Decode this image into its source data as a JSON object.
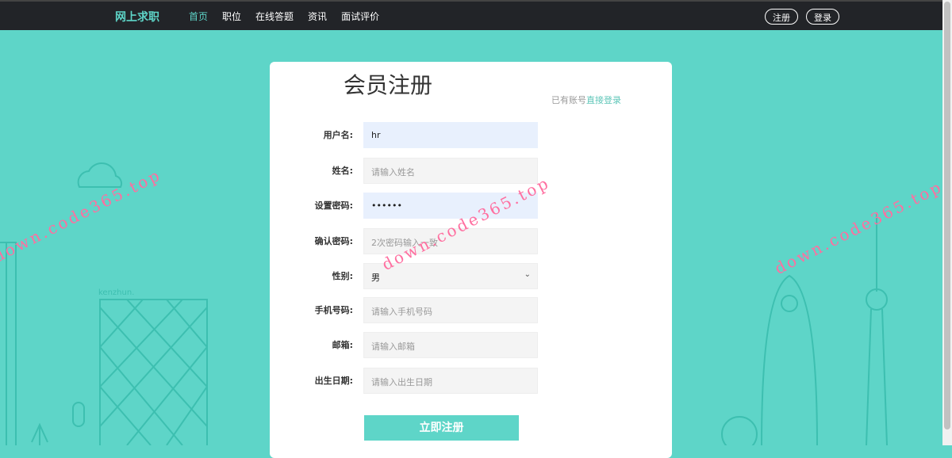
{
  "nav": {
    "brand": "网上求职",
    "items": [
      "首页",
      "职位",
      "在线答题",
      "资讯",
      "面试评价"
    ],
    "register": "注册",
    "login": "登录"
  },
  "form": {
    "title": "会员注册",
    "have_account": "已有账号",
    "direct_login": "直接登录",
    "fields": [
      {
        "label": "用户名:",
        "value": "hr",
        "placeholder": ""
      },
      {
        "label": "姓名:",
        "value": "",
        "placeholder": "请输入姓名"
      },
      {
        "label": "设置密码:",
        "value": "••••••",
        "placeholder": ""
      },
      {
        "label": "确认密码:",
        "value": "",
        "placeholder": "2次密码输入一致"
      },
      {
        "label": "性别:",
        "value": "男",
        "placeholder": ""
      },
      {
        "label": "手机号码:",
        "value": "",
        "placeholder": "请输入手机号码"
      },
      {
        "label": "邮箱:",
        "value": "",
        "placeholder": "请输入邮箱"
      },
      {
        "label": "出生日期:",
        "value": "",
        "placeholder": "请输入出生日期"
      }
    ],
    "submit": "立即注册"
  },
  "background": {
    "sign": "kenzhun."
  },
  "watermark": "down.code365.top"
}
